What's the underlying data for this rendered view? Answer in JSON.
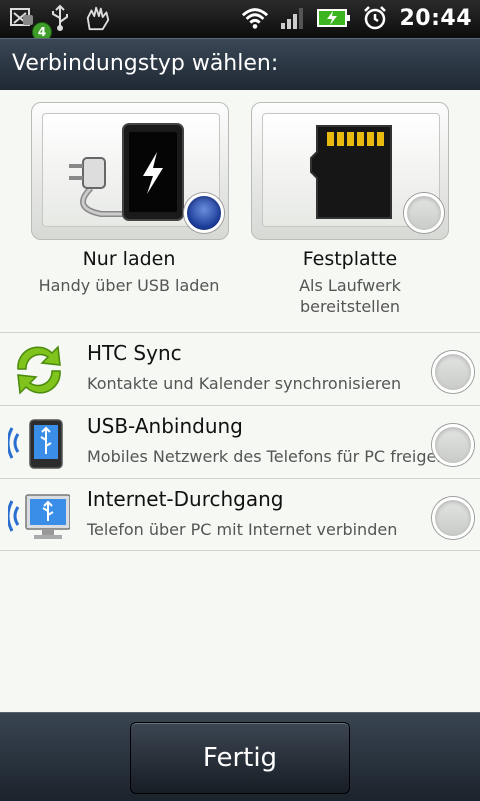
{
  "status_bar": {
    "notification_count": "4",
    "time": "20:44",
    "icons": [
      "usb-debug-icon",
      "usb-icon",
      "hand-icon",
      "wifi-icon",
      "signal-icon",
      "battery-charging-icon",
      "alarm-icon"
    ]
  },
  "title": "Verbindungstyp wählen:",
  "options_top": [
    {
      "title": "Nur laden",
      "subtitle_line1": "Handy über USB laden",
      "subtitle_line2": "",
      "selected": true,
      "icon": "charger-phone-icon"
    },
    {
      "title": "Festplatte",
      "subtitle_line1": "Als Laufwerk",
      "subtitle_line2": "bereitstellen",
      "selected": false,
      "icon": "sd-card-icon"
    }
  ],
  "list_options": [
    {
      "title": "HTC Sync",
      "subtitle": "Kontakte und Kalender synchronisieren",
      "icon": "sync-icon",
      "selected": false
    },
    {
      "title": "USB-Anbindung",
      "subtitle": "Mobiles Netzwerk des Telefons für PC freigeben",
      "icon": "usb-tether-icon",
      "selected": false
    },
    {
      "title": "Internet-Durchgang",
      "subtitle": "Telefon über PC mit Internet verbinden",
      "icon": "internet-pass-icon",
      "selected": false
    }
  ],
  "done_label": "Fertig",
  "colors": {
    "selected_radio": "#1c3e9a",
    "badge": "#3f9d2a"
  }
}
